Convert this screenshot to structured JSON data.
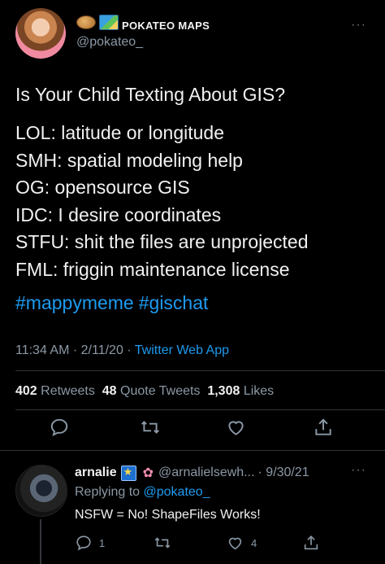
{
  "author": {
    "display_name": "POKATEO MAPS",
    "handle": "@pokateo_",
    "emoji_icons": [
      "potato-icon",
      "world-map-icon"
    ]
  },
  "tweet": {
    "title": "Is Your Child Texting About GIS?",
    "lines": [
      "LOL: latitude or longitude",
      "SMH: spatial modeling help",
      "OG: opensource GIS",
      "IDC: I desire coordinates",
      "STFU: shit the files are unprojected",
      "FML: friggin maintenance license"
    ],
    "hashtags": [
      "#mappymeme",
      "#gischat"
    ],
    "time": "11:34 AM",
    "date": "2/11/20",
    "source": "Twitter Web App",
    "separator": "·"
  },
  "stats": {
    "retweets_count": "402",
    "retweets_label": "Retweets",
    "quotes_count": "48",
    "quotes_label": "Quote Tweets",
    "likes_count": "1,308",
    "likes_label": "Likes"
  },
  "reply": {
    "name": "arnalie",
    "handle": "@arnalielsewh...",
    "date": "· 9/30/21",
    "replying_prefix": "Replying to",
    "replying_to": "@pokateo_",
    "text": "NSFW = No! ShapeFiles Works!",
    "reply_count": "1",
    "like_count": "4"
  },
  "colors": {
    "background": "#000000",
    "text": "#e7e9ea",
    "muted": "#8b98a5",
    "accent": "#1d9bf0",
    "divider": "#2f3336"
  },
  "more_glyph": "···"
}
